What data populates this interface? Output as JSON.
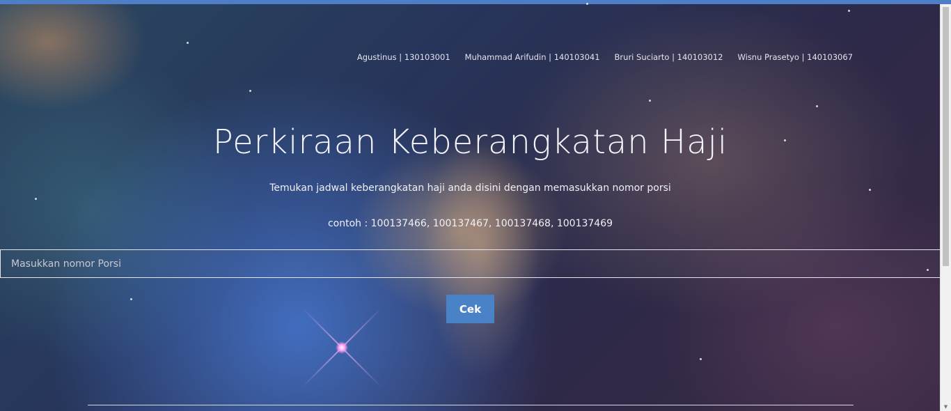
{
  "colors": {
    "accent": "#4a82c7",
    "topbar": "#4e7fc6"
  },
  "nav": {
    "items": [
      {
        "label": "Agustinus | 130103001"
      },
      {
        "label": "Muhammad Arifudin | 140103041"
      },
      {
        "label": "Bruri Suciarto | 140103012"
      },
      {
        "label": "Wisnu Prasetyo | 140103067"
      }
    ]
  },
  "hero": {
    "title": "Perkiraan Keberangkatan Haji",
    "subtitle": "Temukan jadwal keberangkatan haji anda disini dengan memasukkan nomor porsi",
    "example": "contoh : 100137466, 100137467, 100137468, 100137469"
  },
  "search": {
    "placeholder": "Masukkan nomor Porsi",
    "value": "",
    "button_label": "Cek"
  },
  "scrollbar": {
    "icon": "arrow-down-icon"
  }
}
